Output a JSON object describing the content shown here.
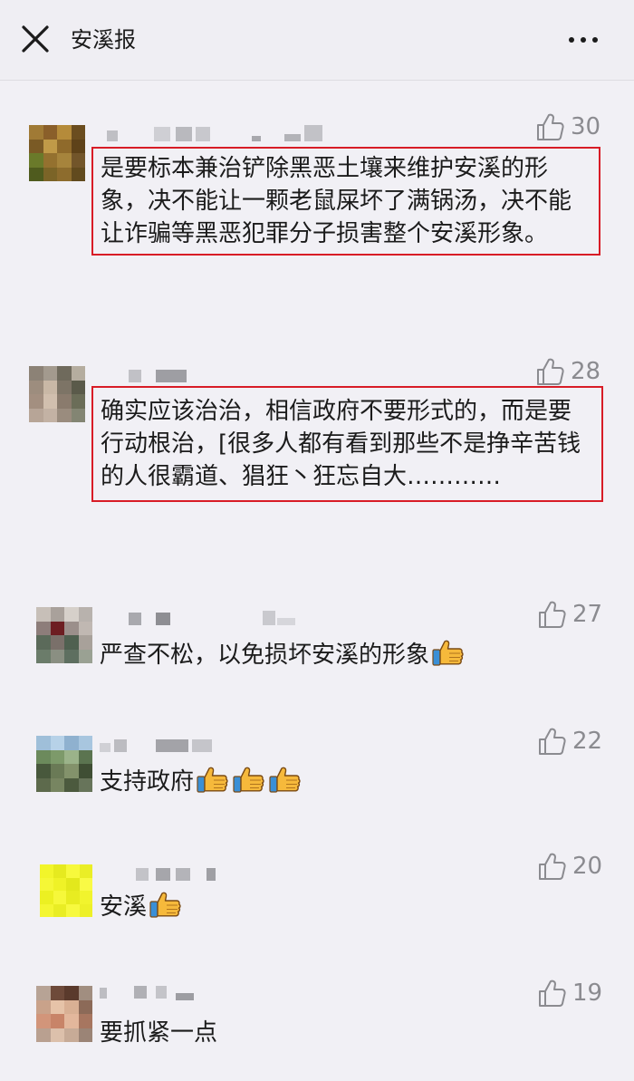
{
  "header": {
    "title": "安溪报",
    "close_icon": "close-icon",
    "more_icon": "more-dots-icon"
  },
  "colors": {
    "highlight_box": "#d81c26",
    "background": "#f1f0f5",
    "like_gray": "#8b8b90"
  },
  "comments": [
    {
      "likes": "30",
      "text": "是要标本兼治铲除黑恶土壤来维护安溪的形象，决不能让一颗老鼠屎坏了满锅汤，决不能让诈骗等黑恶犯罪分子损害整个安溪形象。",
      "highlighted": true
    },
    {
      "likes": "28",
      "text": "确实应该治治，相信政府不要形式的，而是要行动根治，[很多人都有看到那些不是挣辛苦钱的人很霸道、猖狂丶狂忘自大…………",
      "highlighted": true
    },
    {
      "likes": "27",
      "text": "严查不松，以免损坏安溪的形象",
      "emoji": "thumbs-up-emoji",
      "highlighted": false
    },
    {
      "likes": "22",
      "text": "支持政府",
      "emoji": "thumbs-up-emoji x3",
      "highlighted": false
    },
    {
      "likes": "20",
      "text": "安溪",
      "emoji": "thumbs-up-emoji",
      "highlighted": false
    },
    {
      "likes": "19",
      "text": "要抓紧一点",
      "highlighted": false
    }
  ]
}
